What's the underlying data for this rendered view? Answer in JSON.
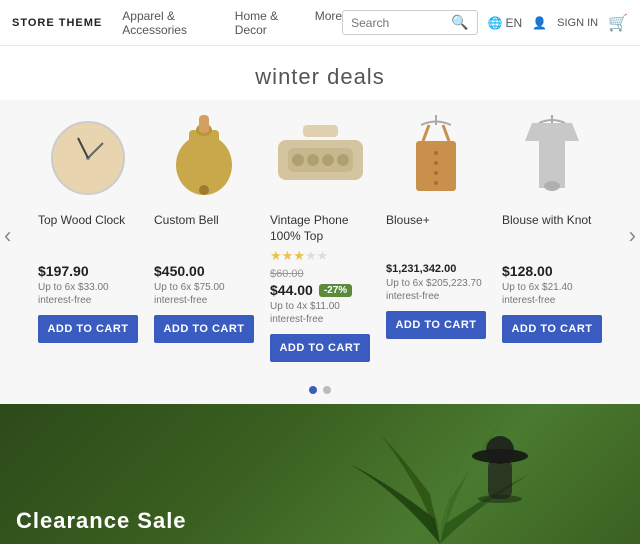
{
  "header": {
    "logo": "STORE THEME",
    "nav": [
      {
        "label": "Apparel & Accessories"
      },
      {
        "label": "Home & Decor"
      },
      {
        "label": "More"
      }
    ],
    "search_placeholder": "Search",
    "lang": "EN",
    "sign_in": "SIGN IN"
  },
  "section": {
    "title": "winter deals"
  },
  "products": [
    {
      "id": "top-wood-clock",
      "name": "Top Wood Clock",
      "stars": 0,
      "price": "$197.90",
      "old_price": null,
      "discount": null,
      "installment": "Up to 6x $33.00 interest-free",
      "add_to_cart": "ADD TO CART",
      "image_type": "clock"
    },
    {
      "id": "custom-bell",
      "name": "Custom Bell",
      "stars": 0,
      "price": "$450.00",
      "old_price": null,
      "discount": null,
      "installment": "Up to 6x $75.00 interest-free",
      "add_to_cart": "ADD TO CART",
      "image_type": "bell"
    },
    {
      "id": "vintage-phone",
      "name": "Vintage Phone 100% Top",
      "stars": 3,
      "price": "$44.00",
      "old_price": "$60.00",
      "discount": "-27%",
      "installment": "Up to 4x $11.00 interest-free",
      "add_to_cart": "ADD TO CART",
      "image_type": "phone"
    },
    {
      "id": "blouse-plus",
      "name": "Blouse+",
      "stars": 0,
      "price": "$1,231,342.00",
      "old_price": null,
      "discount": null,
      "installment": "Up to 6x $205,223.70 interest-free",
      "add_to_cart": "ADD TO CART",
      "image_type": "blouse"
    },
    {
      "id": "blouse-knot",
      "name": "Blouse with Knot",
      "stars": 0,
      "price": "$128.00",
      "old_price": null,
      "discount": null,
      "installment": "Up to 6x $21.40 interest-free",
      "add_to_cart": "ADD TO CART",
      "image_type": "tshirt"
    }
  ],
  "carousel": {
    "left_arrow": "‹",
    "right_arrow": "›",
    "dots": [
      {
        "active": true
      },
      {
        "active": false
      }
    ]
  },
  "bottom": {
    "title": "Clearance Sale"
  }
}
